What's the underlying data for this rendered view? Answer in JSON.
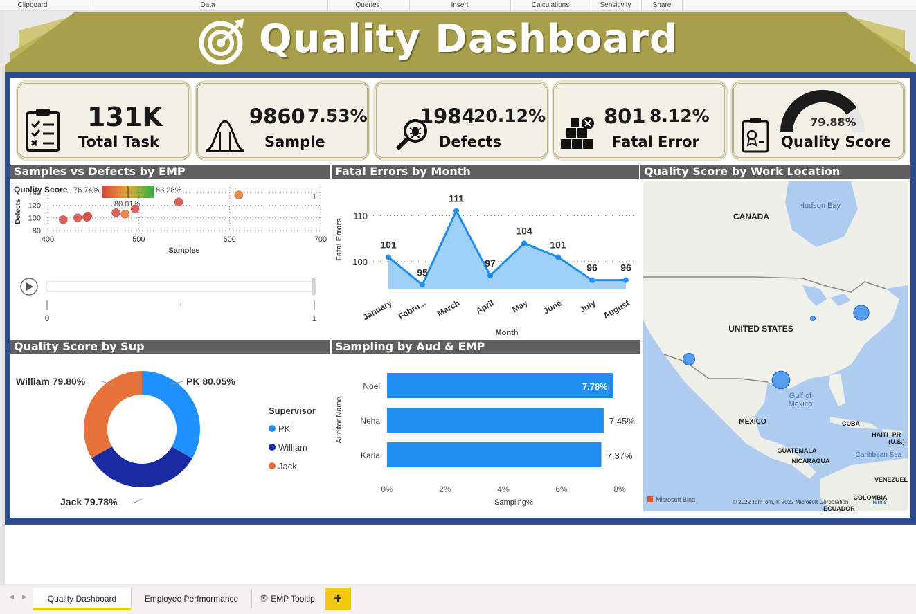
{
  "ribbon": {
    "groups": [
      "Clipboard",
      "Data",
      "Queries",
      "Insert",
      "Calculations",
      "Sensitivity",
      "Share"
    ]
  },
  "report": {
    "title": "Quality Dashboard",
    "colors": {
      "banner": "#a79f4a",
      "frame": "#2b4d8e",
      "accent": "#1e90ff",
      "donut_pk": "#1e90ff",
      "donut_william": "#1a2aa1",
      "donut_jack": "#e8733a"
    }
  },
  "kpis": {
    "total_task": {
      "value": "131K",
      "label": "Total Task"
    },
    "sample": {
      "value": "9860",
      "pct": "7.53%",
      "label": "Sample"
    },
    "defects": {
      "value": "1984",
      "pct": "20.12%",
      "label": "Defects"
    },
    "fatal_error": {
      "value": "801",
      "pct": "8.12%",
      "label": "Fatal Error"
    },
    "quality_score": {
      "value": "79.88%",
      "label": "Quality Score",
      "gauge_fraction": 0.7988
    }
  },
  "visuals": {
    "scatter": {
      "title": "Samples vs Defects by EMP",
      "legend_title": "Quality Score",
      "legend_min": "76.74%",
      "legend_max": "83.28%",
      "legend_mid": "80.01%",
      "play_axis_start": "0",
      "play_axis_end": "1",
      "frame_label": "1"
    },
    "fatal_by_month": {
      "title": "Fatal Errors by Month"
    },
    "location": {
      "title": "Quality Score by Work Location",
      "labels": {
        "canada": "CANADA",
        "hudson": "Hudson Bay",
        "us": "UNITED STATES",
        "gulf": "Gulf of\nMexico",
        "mexico": "MEXICO",
        "cuba": "CUBA",
        "haiti": "HAITI",
        "pr": "PR\n(U.S.)",
        "guatemala": "GUATEMALA",
        "nicaragua": "NICARAGUA",
        "caribbean": "Caribbean Sea",
        "venezuela": "VENEZUEL",
        "colombia": "COLOMBIA",
        "ecuador": "ECUADOR"
      },
      "bing": "Microsoft Bing",
      "copyright": "© 2022 TomTom, © 2022 Microsoft Corporation",
      "terms": "Terms",
      "bubbles": [
        {
          "name": "west-coast",
          "size": 1
        },
        {
          "name": "great-lakes",
          "size": 0.4
        },
        {
          "name": "east-coast",
          "size": 1.3
        },
        {
          "name": "gulf",
          "size": 1.5
        }
      ]
    },
    "quality_by_sup": {
      "title": "Quality Score by Sup",
      "legend_title": "Supervisor"
    },
    "sampling": {
      "title": "Sampling by Aud & EMP"
    }
  },
  "chart_data": [
    {
      "type": "scatter",
      "title": "Samples vs Defects by EMP",
      "xlabel": "Samples",
      "ylabel": "Defects",
      "xlim": [
        400,
        700
      ],
      "ylim": [
        80,
        140
      ],
      "xticks": [
        400,
        500,
        600,
        700
      ],
      "yticks": [
        80,
        100,
        120,
        140
      ],
      "points": [
        {
          "x": 417,
          "y": 97,
          "score": 0.1
        },
        {
          "x": 433,
          "y": 100,
          "score": 0.15
        },
        {
          "x": 443,
          "y": 101,
          "score": 0.18
        },
        {
          "x": 444,
          "y": 103,
          "score": 0.22
        },
        {
          "x": 475,
          "y": 108,
          "score": 0.3
        },
        {
          "x": 485,
          "y": 106,
          "score": 0.6
        },
        {
          "x": 496,
          "y": 114,
          "score": 0.25
        },
        {
          "x": 544,
          "y": 125,
          "score": 0.2
        },
        {
          "x": 610,
          "y": 136,
          "score": 0.45
        }
      ]
    },
    {
      "type": "area",
      "title": "Fatal Errors by Month",
      "xlabel": "Month",
      "ylabel": "Fatal Errors",
      "categories": [
        "January",
        "February",
        "March",
        "April",
        "May",
        "June",
        "July",
        "August"
      ],
      "tick_labels": [
        "January",
        "Febru...",
        "March",
        "April",
        "May",
        "June",
        "July",
        "August"
      ],
      "values": [
        101,
        95,
        111,
        97,
        104,
        101,
        96,
        96
      ],
      "yticks": [
        100,
        110
      ],
      "ylim": [
        94,
        112
      ],
      "grid": true
    },
    {
      "type": "pie",
      "title": "Quality Score by Sup",
      "slices": [
        {
          "label": "PK",
          "value": 80.05,
          "display": "PK 80.05%",
          "color": "#1e90ff"
        },
        {
          "label": "William",
          "value": 79.8,
          "display": "William 79.80%",
          "color": "#1a2aa1"
        },
        {
          "label": "Jack",
          "value": 79.78,
          "display": "Jack 79.78%",
          "color": "#e8733a"
        }
      ]
    },
    {
      "type": "bar",
      "title": "Sampling by Aud & EMP",
      "xlabel": "Sampling%",
      "ylabel": "Auditor Name",
      "categories": [
        "Noel",
        "Neha",
        "Karla"
      ],
      "values": [
        7.78,
        7.45,
        7.37
      ],
      "labels": [
        "7.78%",
        "7.45%",
        "7.37%"
      ],
      "xticks": [
        "0%",
        "2%",
        "4%",
        "6%",
        "8%"
      ],
      "xlim": [
        0,
        8
      ]
    }
  ],
  "tabs": [
    {
      "label": "Quality Dashboard",
      "active": true
    },
    {
      "label": "Employee Perfmormance",
      "active": false
    },
    {
      "label": "EMP Tooltip",
      "active": false,
      "hidden_icon": true
    }
  ],
  "add_tab_label": "+"
}
